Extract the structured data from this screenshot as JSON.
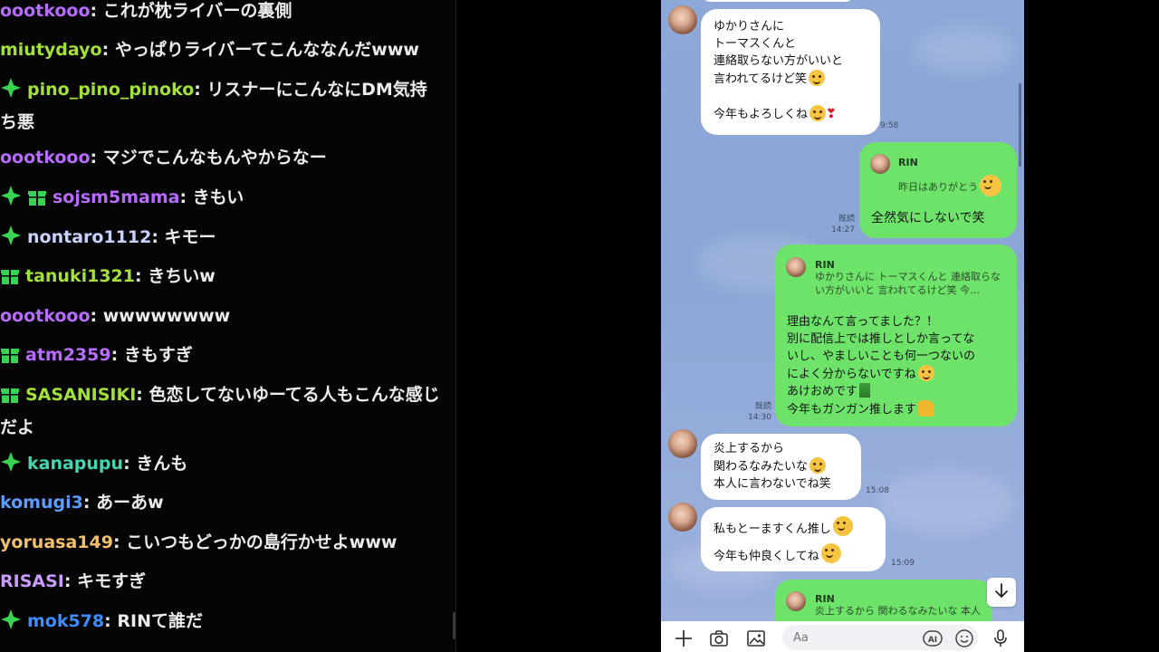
{
  "chat": {
    "messages": [
      {
        "user": "oootkooo",
        "text": "これが枕ライバーの裏側",
        "color": "#b76bff",
        "badges": []
      },
      {
        "user": "miutydayo",
        "text": "やっぱりライバーてこんななんだwww",
        "color": "#a2e03a",
        "badges": []
      },
      {
        "user": "pino_pino_pinoko",
        "text": "リスナーにこんなにDM気持ち悪",
        "color": "#a2e03a",
        "badges": [
          "sparkle-badge"
        ]
      },
      {
        "user": "oootkooo",
        "text": "マジでこんなもんやからなー",
        "color": "#b76bff",
        "badges": []
      },
      {
        "user": "sojsm5mama",
        "text": "きもい",
        "color": "#b76bff",
        "badges": [
          "sparkle-badge",
          "gift-badge"
        ]
      },
      {
        "user": "nontaro1112",
        "text": "キモー",
        "color": "#c9d2ff",
        "badges": [
          "sparkle-badge"
        ]
      },
      {
        "user": "tanuki1321",
        "text": "きちいw",
        "color": "#a2e03a",
        "badges": [
          "gift-badge"
        ]
      },
      {
        "user": "oootkooo",
        "text": "wwwwwwww",
        "color": "#b76bff",
        "badges": []
      },
      {
        "user": "atm2359",
        "text": "きもすぎ",
        "color": "#b76bff",
        "badges": [
          "gift-badge"
        ]
      },
      {
        "user": "SASANISIKI",
        "text": "色恋してないゆーてる人もこんな感じだよ",
        "color": "#a2e03a",
        "badges": [
          "gift-badge"
        ]
      },
      {
        "user": "kanapupu",
        "text": "きんも",
        "color": "#43d6b0",
        "badges": [
          "sparkle-badge"
        ]
      },
      {
        "user": "komugi3",
        "text": "あーあw",
        "color": "#5b9cff",
        "badges": []
      },
      {
        "user": "yoruasa149",
        "text": "こいつもどっかの島行かせよwww",
        "color": "#f2c06b",
        "badges": []
      },
      {
        "user": "RISASI",
        "text": "キモすぎ",
        "color": "#c99cff",
        "badges": []
      },
      {
        "user": "mok578",
        "text": "RINて誰だ",
        "color": "#3f8cff",
        "badges": [
          "sparkle-badge"
        ]
      }
    ]
  },
  "line": {
    "messages": [
      {
        "dir": "in",
        "lines": [
          "ゆかりさんに",
          "トーマスくんと",
          "連絡取らない方がいいと",
          "言われてるけど笑",
          "",
          "今年もよろしくね"
        ],
        "time": "9:58"
      },
      {
        "dir": "out",
        "quote": {
          "name": "RIN",
          "text": "昨日はありがとう"
        },
        "lines": [
          "全然気にしないで笑"
        ],
        "read": "既読",
        "time": "14:27"
      },
      {
        "dir": "out",
        "quote": {
          "name": "RIN",
          "text_lines": [
            "ゆかりさんに トーマスくんと 連絡取らな",
            "い方がいいと 言われてるけど笑 今…"
          ]
        },
        "lines": [
          "理由なんて言ってました？！",
          "別に配信上では推しとしか言ってな",
          "いし、やましいことも何一つないの",
          "によく分からないですね",
          "あけおめです",
          "今年もガンガン推します"
        ],
        "read": "既読",
        "time": "14:30"
      },
      {
        "dir": "in",
        "lines": [
          "炎上するから",
          "関わるなみたいな",
          "本人に言わないでね笑"
        ],
        "time": "15:08"
      },
      {
        "dir": "in",
        "lines": [
          "私もとーますくん推し",
          "今年も仲良くしてね"
        ],
        "time": "15:09"
      },
      {
        "dir": "out",
        "quote": {
          "name": "RIN",
          "text": "炎上するから 関わるなみたいな 本人"
        },
        "lines": [],
        "read": "",
        "time": ""
      }
    ],
    "input": {
      "placeholder": "Aa"
    },
    "icons": {
      "plus": "plus-icon",
      "camera": "camera-icon",
      "image": "image-icon",
      "ai": "ai-icon",
      "emoji": "emoji-icon",
      "mic": "mic-icon",
      "scroll_down": "arrow-down-icon"
    },
    "colors": {
      "incoming": "#ffffff",
      "outgoing": "#6ee36a",
      "background": "#8ea8d8"
    }
  }
}
